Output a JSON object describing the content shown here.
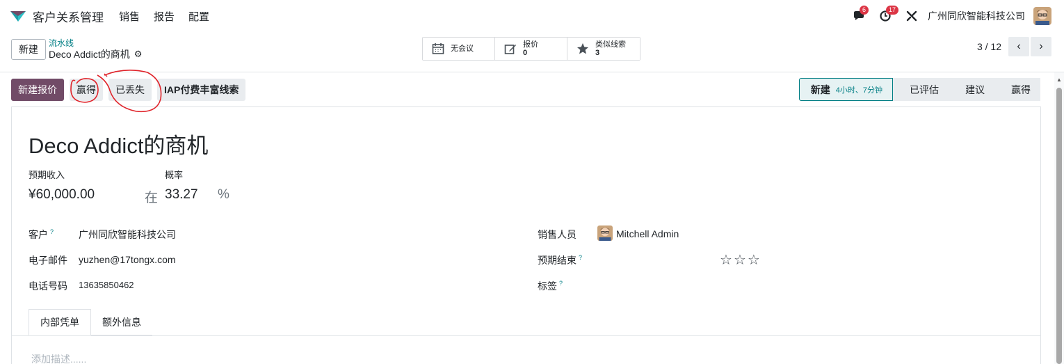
{
  "app": {
    "name": "客户关系管理",
    "menu": [
      "销售",
      "报告",
      "配置"
    ],
    "messages_badge": "6",
    "activities_badge": "17",
    "company": "广州同欣智能科技公司"
  },
  "control": {
    "new_label": "新建",
    "breadcrumb_parent": "流水线",
    "breadcrumb_current": "Deco Addict的商机",
    "smart_buttons": [
      {
        "label": "无会议",
        "count": ""
      },
      {
        "label": "报价",
        "count": "0"
      },
      {
        "label": "类似线索",
        "count": "3"
      }
    ],
    "pager": "3 / 12"
  },
  "actions": {
    "new_quote": "新建报价",
    "won": "赢得",
    "lost": "已丢失",
    "enrich": "IAP付费丰富线索"
  },
  "stages": {
    "current": "新建",
    "duration": "4小时、7分钟",
    "qualified": "已评估",
    "proposition": "建议",
    "won": "赢得"
  },
  "form": {
    "title": "Deco Addict的商机",
    "expected_revenue_label": "预期收入",
    "probability_label": "概率",
    "expected_revenue": "¥60,000.00",
    "at_label": "在",
    "probability": "33.27",
    "percent": "%",
    "customer_label": "客户",
    "customer": "广州同欣智能科技公司",
    "email_label": "电子邮件",
    "email": "yuzhen@17tongx.com",
    "phone_label": "电话号码",
    "phone": "13635850462",
    "salesperson_label": "销售人员",
    "salesperson": "Mitchell Admin",
    "expected_close_label": "预期结束",
    "tags_label": "标签",
    "help_mark": "?",
    "priority_stars": 0,
    "tabs": [
      "内部凭单",
      "额外信息"
    ],
    "description_placeholder": "添加描述......"
  }
}
